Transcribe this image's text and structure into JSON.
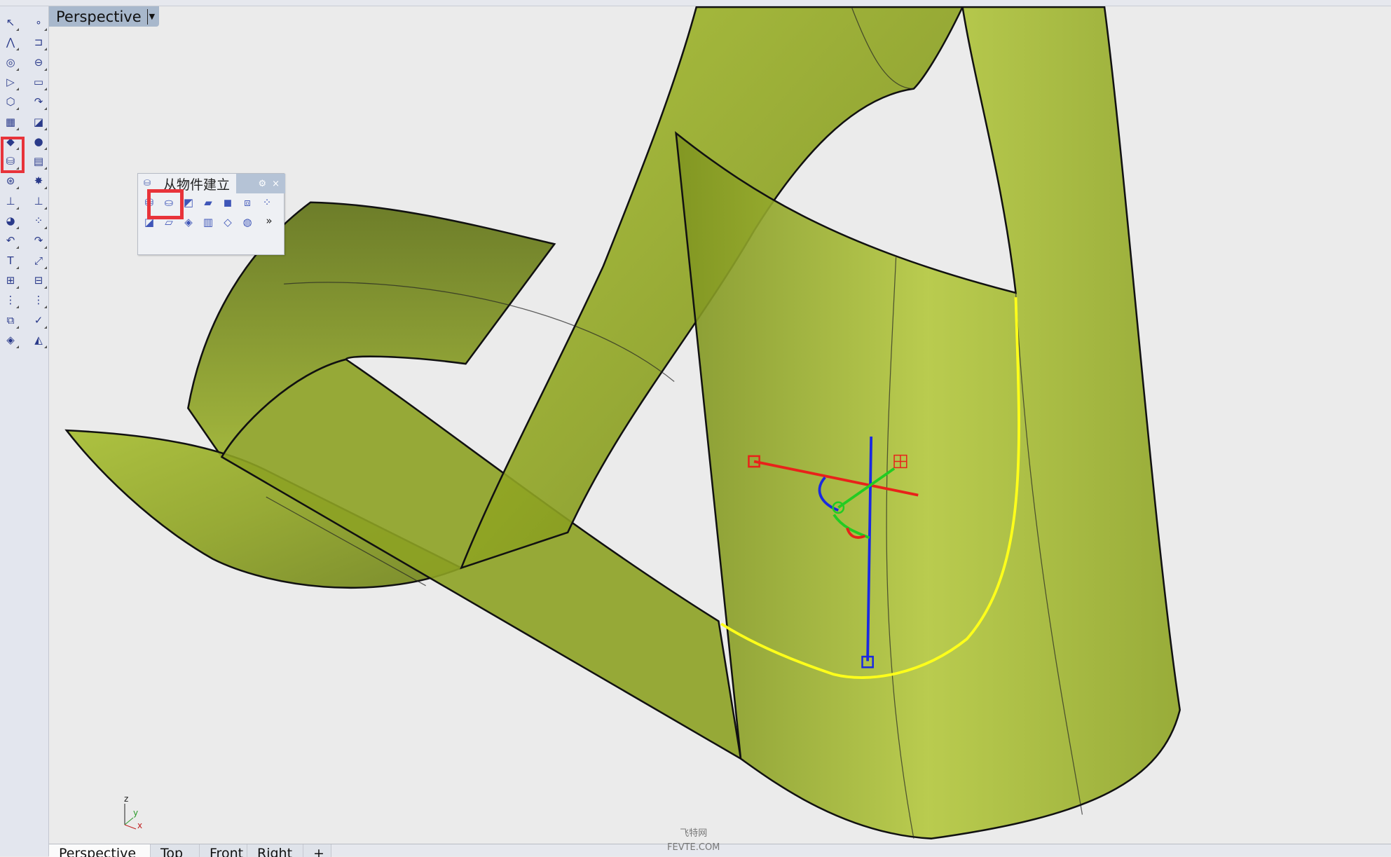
{
  "viewport": {
    "title": "Perspective",
    "dropdown_icon": "caret-down-icon"
  },
  "toolbar": {
    "icons": [
      "select-arrow",
      "point",
      "polyline",
      "curve-control-points",
      "circle",
      "ellipse",
      "arc",
      "rectangle",
      "polygon",
      "fillet",
      "surface-from-points",
      "extrude-surface",
      "box",
      "sphere",
      "extrude-curve-solid",
      "mesh",
      "boolean",
      "explode",
      "split",
      "trim",
      "join-solids",
      "group",
      "offset",
      "fillet-curves",
      "text",
      "scale",
      "transform",
      "dimension",
      "array",
      "history",
      "properties",
      "check",
      "analyze",
      "render"
    ],
    "highlighted": "extrude-curve-solid"
  },
  "popup": {
    "title": "从物件建立",
    "gear": "gear-icon",
    "close": "×",
    "more": "»",
    "icons": [
      "extrude-straight",
      "extrude-tapered",
      "extrude-surface",
      "plane-surface",
      "box-surface",
      "cap-surface",
      "array-points",
      "edge-surface",
      "loft-surface",
      "network-surface",
      "sweep-surface",
      "patch-surface",
      "sphere-nurbs"
    ],
    "highlighted": "extrude-tapered"
  },
  "tabs": [
    "Perspective",
    "Top",
    "Front",
    "Right",
    "+"
  ],
  "active_tab": "Perspective",
  "axes": {
    "z": "z",
    "y": "y",
    "x": "x"
  },
  "watermark": {
    "line1": "飞特网",
    "line2": "FEVTE.COM"
  },
  "colors": {
    "surface": "#9fb22a",
    "selected_edge": "#ffff1a",
    "gizmo_x": "#e8221a",
    "gizmo_y": "#22cc22",
    "gizmo_z": "#1a2ae0",
    "highlight": "#e8333a"
  }
}
